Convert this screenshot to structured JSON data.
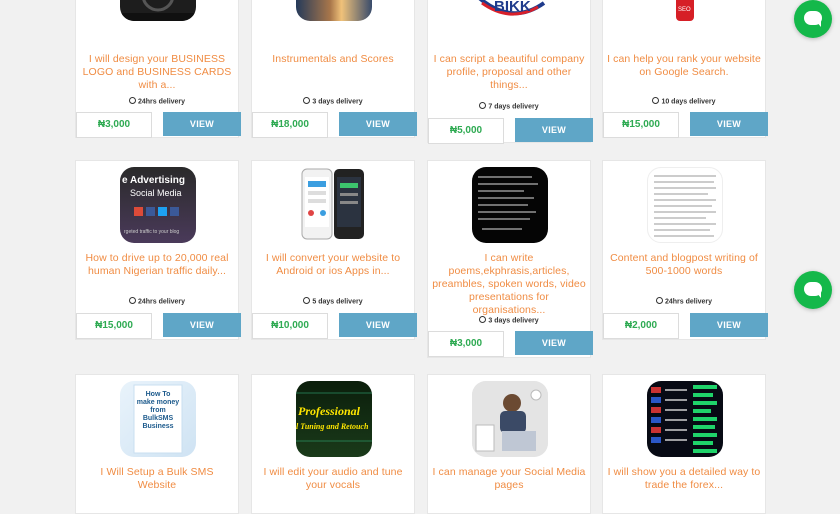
{
  "cards": [
    {
      "title": "I will design your BUSINESS LOGO and BUSINESS CARDS with a...",
      "delivery": "24hrs delivery",
      "price": "₦3,000",
      "button": "VIEW"
    },
    {
      "title": "Instrumentals and Scores",
      "delivery": "3 days delivery",
      "price": "₦18,000",
      "button": "VIEW"
    },
    {
      "title": "I can script a beautiful company profile, proposal and other things...",
      "delivery": "7 days delivery",
      "price": "₦5,000",
      "button": "VIEW"
    },
    {
      "title": "I can help you rank your website on Google Search.",
      "delivery": "10 days delivery",
      "price": "₦15,000",
      "button": "VIEW"
    },
    {
      "title": "How to drive up to 20,000 real human Nigerian traffic daily...",
      "delivery": "24hrs delivery",
      "price": "₦15,000",
      "button": "VIEW"
    },
    {
      "title": "I will convert your website to Android or ios Apps in...",
      "delivery": "5 days delivery",
      "price": "₦10,000",
      "button": "VIEW"
    },
    {
      "title": "I can write poems,ekphrasis,articles, preambles, spoken words, video presentations for organisations...",
      "delivery": "3 days delivery",
      "price": "₦3,000",
      "button": "VIEW"
    },
    {
      "title": "Content and blogpost writing of 500-1000 words",
      "delivery": "24hrs delivery",
      "price": "₦2,000",
      "button": "VIEW"
    },
    {
      "title": "I Will Setup a Bulk SMS Website",
      "delivery": "",
      "price": "",
      "button": ""
    },
    {
      "title": "I will edit your audio and tune your vocals",
      "delivery": "",
      "price": "",
      "button": ""
    },
    {
      "title": "I can manage your Social Media pages",
      "delivery": "",
      "price": "",
      "button": ""
    },
    {
      "title": "I will show you a detailed way to trade the forex...",
      "delivery": "",
      "price": "",
      "button": ""
    }
  ],
  "thumb_text": {
    "c3": "BIKK",
    "c4": "SEO",
    "c5_line1": "e Advertising",
    "c5_line2": "Social Media",
    "c5_line3": "rgeted traffic to your blog",
    "c9": "How To make money from BulkSMS Business",
    "c10_line1": "Professional",
    "c10_line2": "l Tuning and Retouch"
  },
  "colors": {
    "accent": "#f08c43",
    "price": "#2eaa52",
    "button": "#5fa6c7",
    "chat": "#14b84a"
  },
  "icons": {
    "chat": "whatsapp-chat-icon",
    "clock": "clock-icon"
  }
}
